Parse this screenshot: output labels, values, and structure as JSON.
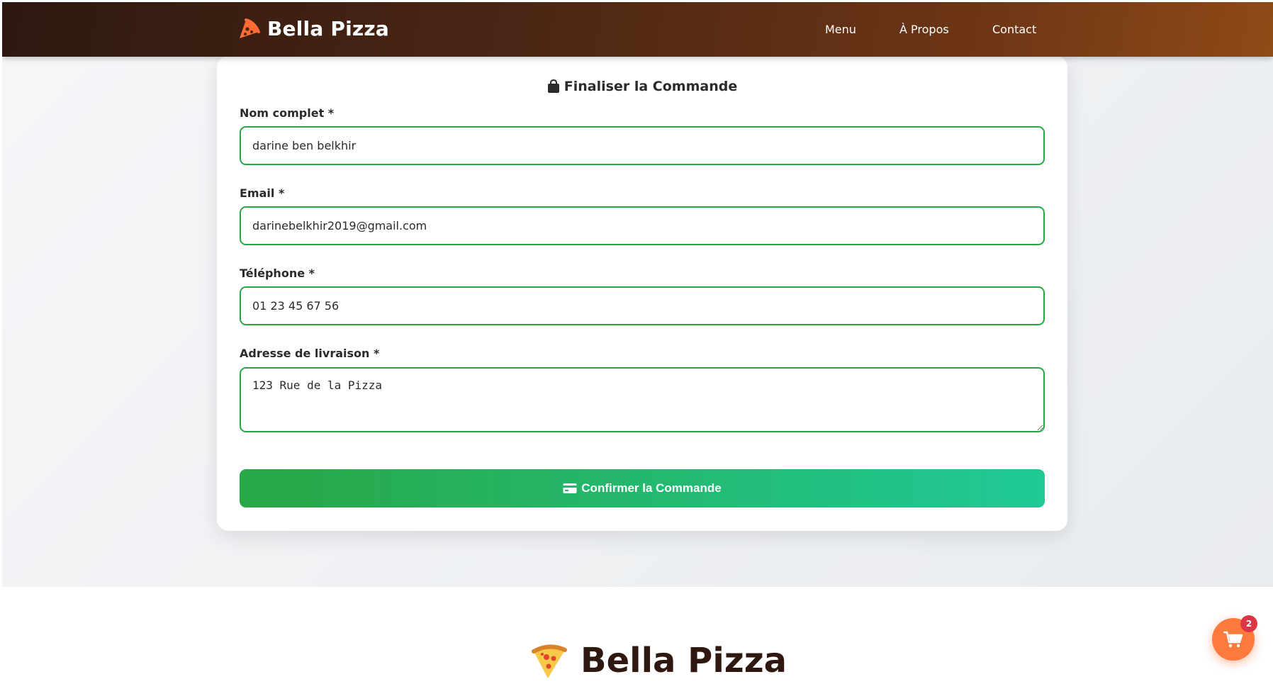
{
  "header": {
    "brand": "Bella Pizza",
    "nav": [
      "Menu",
      "À Propos",
      "Contact"
    ]
  },
  "checkout": {
    "title": "Finaliser la Commande",
    "fields": {
      "name": {
        "label": "Nom complet *",
        "value": "darine ben belkhir"
      },
      "email": {
        "label": "Email *",
        "value": "darinebelkhir2019@gmail.com"
      },
      "phone": {
        "label": "Téléphone *",
        "value": "01 23 45 67 56"
      },
      "address": {
        "label": "Adresse de livraison *",
        "value": "123 Rue de la Pizza"
      }
    },
    "confirm_label": "Confirmer la Commande"
  },
  "footer": {
    "brand": "Bella Pizza"
  },
  "cart": {
    "count": "2"
  },
  "colors": {
    "header_start": "#2e1810",
    "header_end": "#8f4a17",
    "accent_orange": "#ff6b35",
    "input_border": "#28a745",
    "button_start": "#28a745",
    "button_end": "#20c997",
    "badge": "#dc3545"
  },
  "icons": {
    "brand": "pizza-slice-icon",
    "title": "shopping-bag-icon",
    "confirm": "credit-card-icon",
    "footer": "pizza-emoji-icon",
    "cart": "shopping-cart-icon"
  }
}
